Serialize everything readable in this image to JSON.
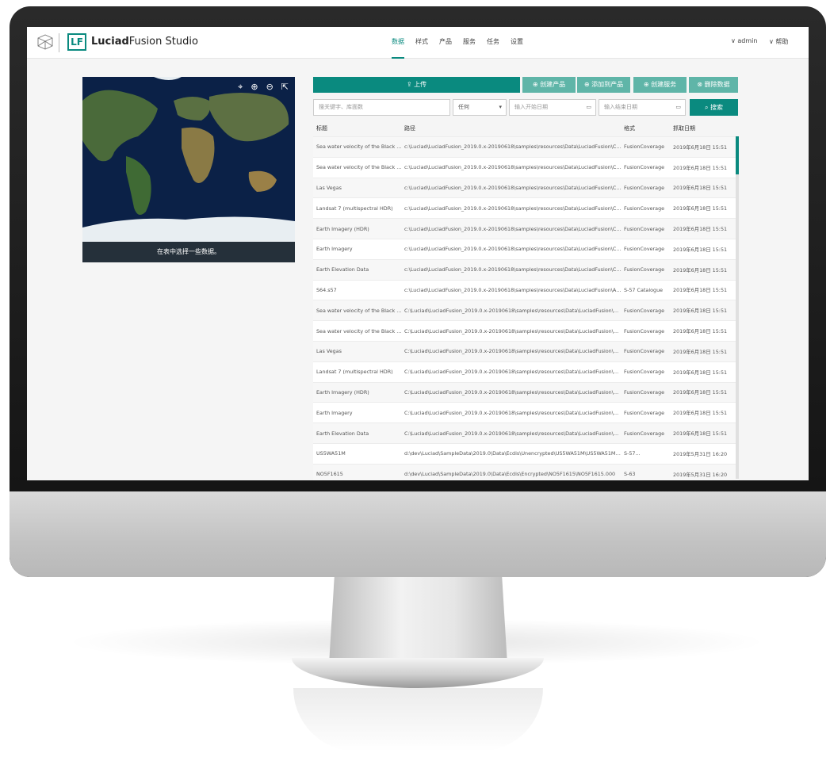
{
  "app": {
    "brand_bold": "Luciad",
    "brand_rest": "Fusion Studio",
    "logo_letters": "LF"
  },
  "nav": {
    "items": [
      "数据",
      "样式",
      "产品",
      "服务",
      "任务",
      "设置"
    ],
    "active_index": 0,
    "user": "∨ admin",
    "help": "∨ 帮助"
  },
  "map": {
    "tools": [
      "⌖",
      "⊕",
      "⊖",
      "⇱"
    ],
    "caption": "在表中选择一些数据。"
  },
  "toolbar": {
    "upload": "上传",
    "create_product": "⊕ 创建产品",
    "add_to_product": "⊕ 添加到产品",
    "create_service": "⊕ 创建服务",
    "delete_data": "⊗ 删除数据"
  },
  "filters": {
    "keyword_placeholder": "搜关键字、库面数",
    "type_value": "任何",
    "start_date_placeholder": "输入开始日期",
    "end_date_placeholder": "输入结束日期",
    "search_label": "搜索"
  },
  "table": {
    "headers": [
      "标题",
      "路径",
      "格式",
      "抓取日期"
    ],
    "rows": [
      [
        "Sea water velocity of the Black ...",
        "c:\\Luciad\\LuciadFusion_2019.0.x-20190618\\samples\\resources\\Data\\LuciadFusion\\Cove...",
        "FusionCoverage",
        "2019年6月18日 15:51"
      ],
      [
        "Sea water velocity of the Black ...",
        "c:\\Luciad\\LuciadFusion_2019.0.x-20190618\\samples\\resources\\Data\\LuciadFusion\\Cove...",
        "FusionCoverage",
        "2019年6月18日 15:51"
      ],
      [
        "Las Vegas",
        "c:\\Luciad\\LuciadFusion_2019.0.x-20190618\\samples\\resources\\Data\\LuciadFusion\\Cove...",
        "FusionCoverage",
        "2019年6月18日 15:51"
      ],
      [
        "Landsat 7 (multispectral HDR)",
        "c:\\Luciad\\LuciadFusion_2019.0.x-20190618\\samples\\resources\\Data\\LuciadFusion\\Cove...",
        "FusionCoverage",
        "2019年6月18日 15:51"
      ],
      [
        "Earth Imagery (HDR)",
        "c:\\Luciad\\LuciadFusion_2019.0.x-20190618\\samples\\resources\\Data\\LuciadFusion\\Cove...",
        "FusionCoverage",
        "2019年6月18日 15:51"
      ],
      [
        "Earth Imagery",
        "c:\\Luciad\\LuciadFusion_2019.0.x-20190618\\samples\\resources\\Data\\LuciadFusion\\Cove...",
        "FusionCoverage",
        "2019年6月18日 15:51"
      ],
      [
        "Earth Elevation Data",
        "c:\\Luciad\\LuciadFusion_2019.0.x-20190618\\samples\\resources\\Data\\LuciadFusion\\Cove...",
        "FusionCoverage",
        "2019年6月18日 15:51"
      ],
      [
        "S64.s57",
        "c:\\Luciad\\LuciadFusion_2019.0.x-20190618\\samples\\resources\\Data\\LuciadFusion\\Asse...",
        "S-57 Catalogue",
        "2019年6月18日 15:51"
      ],
      [
        "Sea water velocity of the Black ...",
        "C:\\Luciad\\LuciadFusion_2019.0.x-20190618\\samples\\resources\\Data\\LuciadFusion\\Cov...",
        "FusionCoverage",
        "2019年6月18日 15:51"
      ],
      [
        "Sea water velocity of the Black ...",
        "C:\\Luciad\\LuciadFusion_2019.0.x-20190618\\samples\\resources\\Data\\LuciadFusion\\Cov...",
        "FusionCoverage",
        "2019年6月18日 15:51"
      ],
      [
        "Las Vegas",
        "C:\\Luciad\\LuciadFusion_2019.0.x-20190618\\samples\\resources\\Data\\LuciadFusion\\Cov...",
        "FusionCoverage",
        "2019年6月18日 15:51"
      ],
      [
        "Landsat 7 (multispectral HDR)",
        "C:\\Luciad\\LuciadFusion_2019.0.x-20190618\\samples\\resources\\Data\\LuciadFusion\\Cov...",
        "FusionCoverage",
        "2019年6月18日 15:51"
      ],
      [
        "Earth Imagery (HDR)",
        "C:\\Luciad\\LuciadFusion_2019.0.x-20190618\\samples\\resources\\Data\\LuciadFusion\\Cov...",
        "FusionCoverage",
        "2019年6月18日 15:51"
      ],
      [
        "Earth Imagery",
        "C:\\Luciad\\LuciadFusion_2019.0.x-20190618\\samples\\resources\\Data\\LuciadFusion\\Cov...",
        "FusionCoverage",
        "2019年6月18日 15:51"
      ],
      [
        "Earth Elevation Data",
        "C:\\Luciad\\LuciadFusion_2019.0.x-20190618\\samples\\resources\\Data\\LuciadFusion\\Cov...",
        "FusionCoverage",
        "2019年6月18日 15:51"
      ],
      [
        "US5WA51M",
        "d:\\dev\\Luciad\\SampleData\\2019.0\\Data\\Ecdis\\Unencrypted\\US5WA51M\\US5WA51M.000",
        "S-57...",
        "2019年5月31日 16:20"
      ],
      [
        "NO5F1615",
        "d:\\dev\\Luciad\\SampleData\\2019.0\\Data\\Ecdis\\Encrypted\\NO5F1615\\NO5F1615.000",
        "S-63",
        "2019年5月31日 16:20"
      ]
    ]
  },
  "colors": {
    "accent": "#0a8a7f",
    "accent_light": "#5fb5a8",
    "map_ocean": "#0b1d3a",
    "caption_bg": "#25303a"
  }
}
